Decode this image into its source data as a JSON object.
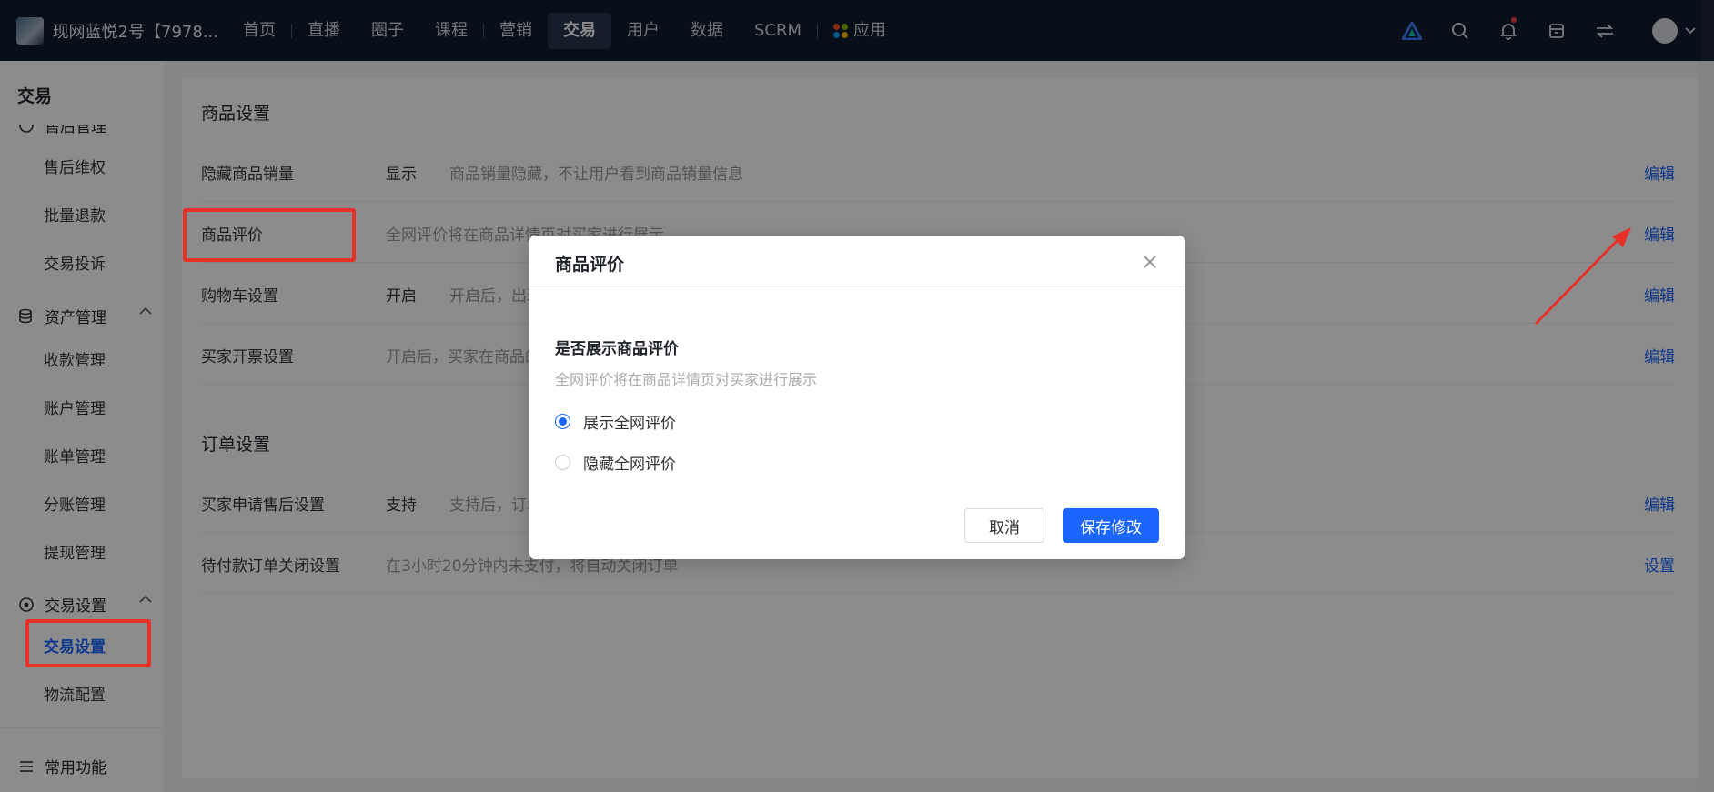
{
  "topbar": {
    "brand_name": "现网蓝悦2号【7978...",
    "nav": [
      "首页",
      "直播",
      "圈子",
      "课程",
      "营销",
      "交易",
      "用户",
      "数据",
      "SCRM",
      "应用"
    ],
    "active_nav": "交易",
    "app_dot_colors": [
      "#f25022",
      "#7fba00",
      "#00a4ef",
      "#ffb900"
    ]
  },
  "sidebar": {
    "title": "交易",
    "partial_group": "售后管理",
    "after_sales_items": [
      "售后维权",
      "批量退款",
      "交易投诉"
    ],
    "asset_group": "资产管理",
    "asset_items": [
      "收款管理",
      "账户管理",
      "账单管理",
      "分账管理",
      "提现管理"
    ],
    "trade_group": "交易设置",
    "trade_items": [
      "交易设置",
      "物流配置"
    ],
    "common_group": "常用功能"
  },
  "content": {
    "goods_section": "商品设置",
    "goods_rows": [
      {
        "label": "隐藏商品销量",
        "value": "显示",
        "desc": "商品销量隐藏，不让用户看到商品销量信息",
        "action": "编辑"
      },
      {
        "label": "商品评价",
        "value": "",
        "desc": "全网评价将在商品详情页对买家进行展示",
        "action": "编辑"
      },
      {
        "label": "购物车设置",
        "value": "开启",
        "desc": "开启后，出现",
        "action": "编辑"
      },
      {
        "label": "买家开票设置",
        "value": "",
        "desc": "开启后，买家在商品的",
        "action": "编辑"
      }
    ],
    "order_section": "订单设置",
    "order_rows": [
      {
        "label": "买家申请售后设置",
        "value": "支持",
        "desc": "支持后，订单",
        "action": "编辑"
      },
      {
        "label": "待付款订单关闭设置",
        "value": "",
        "desc": "在3小时20分钟内未支付，将自动关闭订单",
        "action": "设置"
      }
    ]
  },
  "modal": {
    "title": "商品评价",
    "question": "是否展示商品评价",
    "description": "全网评价将在商品详情页对买家进行展示",
    "options": [
      "展示全网评价",
      "隐藏全网评价"
    ],
    "selected": "展示全网评价",
    "cancel_label": "取消",
    "save_label": "保存修改"
  },
  "colors": {
    "primary": "#1a66ff",
    "annotation_red": "#e8302a",
    "topbar_bg": "#121c2e"
  }
}
